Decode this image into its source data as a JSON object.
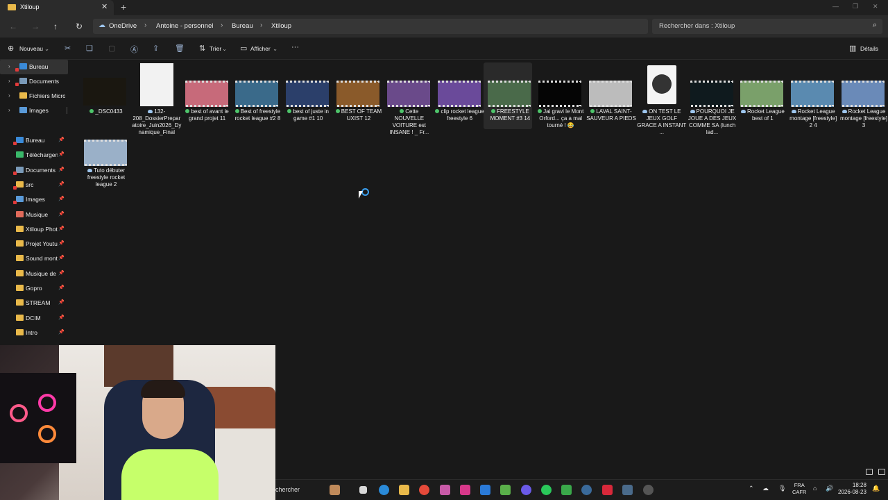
{
  "window": {
    "tab_title": "Xtiloup",
    "tab_close": "✕",
    "new_tab": "+"
  },
  "address": {
    "back": "←",
    "forward": "→",
    "up": "↑",
    "refresh": "↻",
    "breadcrumb": [
      "OneDrive",
      "Antoine - personnel",
      "Bureau",
      "Xtiloup"
    ],
    "search_placeholder": "Rechercher dans : Xtiloup"
  },
  "commandbar": {
    "new_label": "Nouveau",
    "sort_label": "Trier",
    "view_label": "Afficher",
    "more_label": "···",
    "details_label": "Détails"
  },
  "sidebar": {
    "tree": [
      {
        "label": "Bureau",
        "selected": true
      },
      {
        "label": "Documents"
      },
      {
        "label": "Fichiers Micros"
      },
      {
        "label": "Images"
      }
    ],
    "quick": [
      {
        "label": "Bureau"
      },
      {
        "label": "Téléchargem"
      },
      {
        "label": "Documents"
      },
      {
        "label": "src"
      },
      {
        "label": "Images"
      },
      {
        "label": "Musique"
      },
      {
        "label": "Xtiloup Photo"
      },
      {
        "label": "Projet Youtul"
      },
      {
        "label": "Sound monta"
      },
      {
        "label": "Musique de r"
      },
      {
        "label": "Gopro"
      },
      {
        "label": "STREAM"
      },
      {
        "label": "DCIM"
      },
      {
        "label": "Intro"
      }
    ]
  },
  "files": [
    {
      "name": "_DSC0433",
      "status": "ok",
      "color": "#1a1710"
    },
    {
      "name": "132-208_DossierPreparatoire_Juin2026_Dynamique_Final",
      "status": "cloud",
      "color": "#f2f2f2"
    },
    {
      "name": "best of avant le grand projet 11",
      "status": "ok",
      "color": "#c76a7a"
    },
    {
      "name": "Best of freestyle rocket league #2 8",
      "status": "ok",
      "color": "#3a6a8a"
    },
    {
      "name": "best of juste in game #1 10",
      "status": "ok",
      "color": "#2b3f6a"
    },
    {
      "name": "BEST OF TEAM UXIST 12",
      "status": "ok",
      "color": "#8a5a2a"
    },
    {
      "name": "Cette NOUVELLE VOITURE est INSANE ! _ Fr...",
      "status": "ok",
      "color": "#6a4a8a"
    },
    {
      "name": "clip rocket league freestyle 6",
      "status": "ok",
      "color": "#6a4a9a"
    },
    {
      "name": "FREESTYLE MOMENT #3 14",
      "status": "ok",
      "color": "#4a6a4a"
    },
    {
      "name": "Jai gravi le Mont Orford... ça a mal tourné ! 😂",
      "status": "ok",
      "color": "#050505"
    },
    {
      "name": "LAVAL SAINT-SAUVEUR A PIEDS",
      "status": "ok",
      "color": "#bcbcbc"
    },
    {
      "name": "ON TEST LE JEUX GOLF GRACE A INSTANT ...",
      "status": "cloud",
      "color": "#f4f4f4"
    },
    {
      "name": "POURQUOI JE JOUE A DES JEUX COMME SA (lunch lad...",
      "status": "cloud",
      "color": "#0f1a1e"
    },
    {
      "name": "Rocket League best of 1",
      "status": "cloud",
      "color": "#7aa06a"
    },
    {
      "name": "Rocket League montage [freestyle] 2 4",
      "status": "cloud",
      "color": "#5a8ab0"
    },
    {
      "name": "Rocket League montage [freestyle] 3",
      "status": "cloud",
      "color": "#6a8ab8"
    },
    {
      "name": "Tuto débuter freestyle rocket league 2",
      "status": "cloud",
      "color": "#9ab0c8"
    }
  ],
  "taskbar": {
    "search_label": "chercher",
    "lang_line1": "FRA",
    "lang_line2": "CAFR",
    "time": "18:28",
    "date": "2026-08-23"
  },
  "colors": {
    "accent": "#3aa0f0",
    "folder": "#e9b94a",
    "sync_ok": "#4ec56b"
  }
}
